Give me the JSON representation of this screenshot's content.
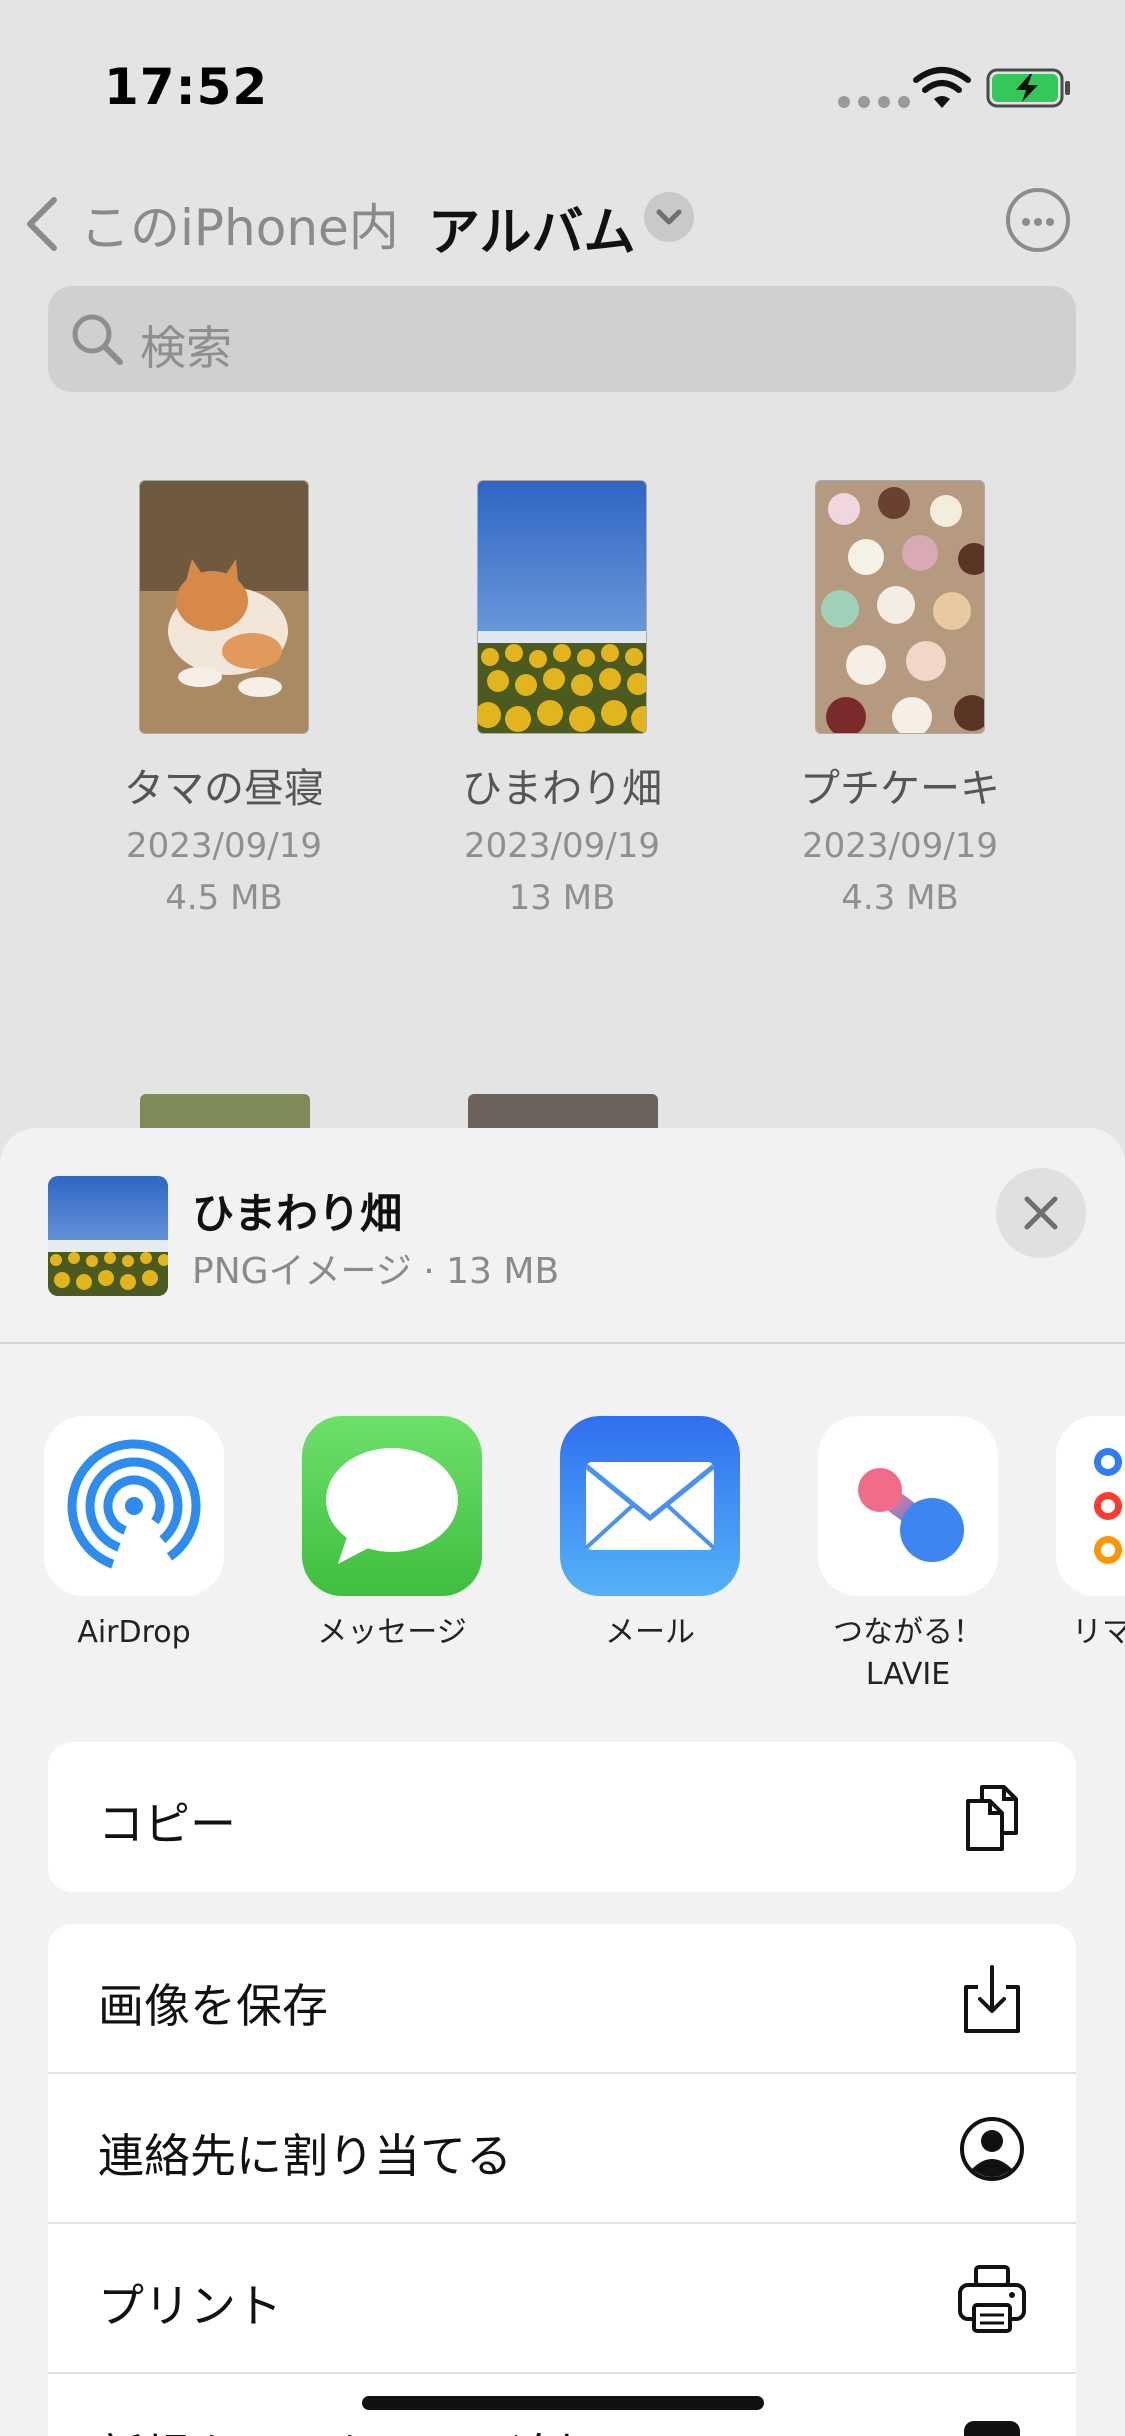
{
  "status_bar": {
    "time": "17:52"
  },
  "nav": {
    "back_label": "このiPhone内",
    "title": "アルバム"
  },
  "search": {
    "placeholder": "検索"
  },
  "files": [
    {
      "name": "タマの昼寝",
      "date": "2023/09/19",
      "size": "4.5 MB"
    },
    {
      "name": "ひまわり畑",
      "date": "2023/09/19",
      "size": "13 MB"
    },
    {
      "name": "プチケーキ",
      "date": "2023/09/19",
      "size": "4.3 MB"
    }
  ],
  "share_sheet": {
    "title": "ひまわり畑",
    "subtitle": "PNGイメージ · 13 MB",
    "apps": [
      {
        "label": "AirDrop",
        "icon": "airdrop-icon"
      },
      {
        "label": "メッセージ",
        "icon": "messages-icon"
      },
      {
        "label": "メール",
        "icon": "mail-icon"
      },
      {
        "label": "つながる！\nLAVIE",
        "icon": "lavie-icon"
      },
      {
        "label": "リマ",
        "icon": "reminders-icon"
      }
    ],
    "actions": [
      {
        "label": "コピー",
        "icon": "copy-icon"
      },
      {
        "label": "画像を保存",
        "icon": "save-image-icon"
      },
      {
        "label": "連絡先に割り当てる",
        "icon": "assign-contact-icon"
      },
      {
        "label": "プリント",
        "icon": "print-icon"
      },
      {
        "label": "新規クイックメモに追加",
        "icon": "quick-note-icon"
      }
    ]
  },
  "colors": {
    "messages_green": "#4cd964",
    "mail_blue": "#2f7cf6",
    "airdrop_blue": "#2d8cf0",
    "battery_green": "#34c759"
  }
}
